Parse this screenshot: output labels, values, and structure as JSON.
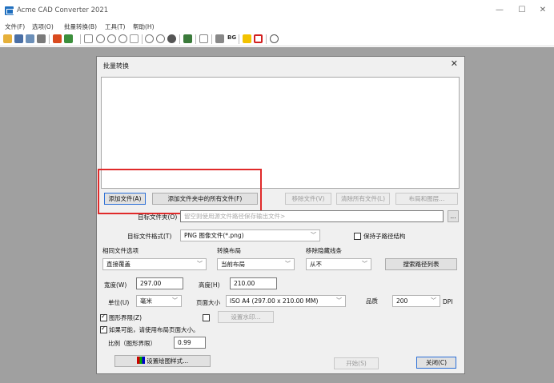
{
  "app": {
    "title": "Acme CAD Converter 2021",
    "controls": {
      "minimize": "—",
      "maximize": "☐",
      "close": "✕"
    }
  },
  "menu": [
    "文件(F)",
    "选项(O)",
    "批量转换(B)",
    "工具(T)",
    "帮助(H)"
  ],
  "toolbar": {
    "bg_label": "BG"
  },
  "dialog": {
    "title": "批量转换",
    "close": "✕",
    "buttons": {
      "add_file": "添加文件(A)",
      "add_folder": "添加文件夹中的所有文件(F)",
      "remove_file": "移除文件(V)",
      "remove_all": "清除所有文件(L)",
      "layout_layers": "布局和图层..."
    },
    "target_folder": {
      "label": "目标文件夹(O)",
      "placeholder": "留空则使用源文件路径保存输出文件>",
      "browse": "..."
    },
    "target_format": {
      "label": "目标文件格式(T)",
      "value": "PNG 图像文件(*.png)",
      "keep_subdir": "保持子路径结构"
    },
    "same_file": {
      "label": "相同文件选项",
      "value": "直接覆盖"
    },
    "convert_layout": {
      "label": "转换布局",
      "value": "当前布局"
    },
    "hidden_lines": {
      "label": "移除隐藏线条",
      "value": "从不"
    },
    "search_paths": "搜索路径列表",
    "width": {
      "label": "宽度(W)",
      "value": "297.00"
    },
    "height": {
      "label": "高度(H)",
      "value": "210.00"
    },
    "unit": {
      "label": "单位(U)",
      "value": "毫米"
    },
    "page_size": {
      "label": "页面大小",
      "value": "ISO A4 (297.00 x 210.00 MM)"
    },
    "quality": {
      "label": "品质",
      "value": "200",
      "unit": "DPI"
    },
    "drawing_bounds": "图形界限(Z)",
    "watermark": "设置水印...",
    "use_layout_size": "如果可能，请使用布局页面大小。",
    "scale": {
      "label": "比例（图形界限）",
      "value": "0.99"
    },
    "plot_style": "设置绘图样式...",
    "start": "开始(S)",
    "close_button": "关闭(C)"
  },
  "colors": {
    "highlight": "#e02a2a",
    "workspace": "#a0a0a0",
    "dialog_bg": "#f0f0f0"
  }
}
